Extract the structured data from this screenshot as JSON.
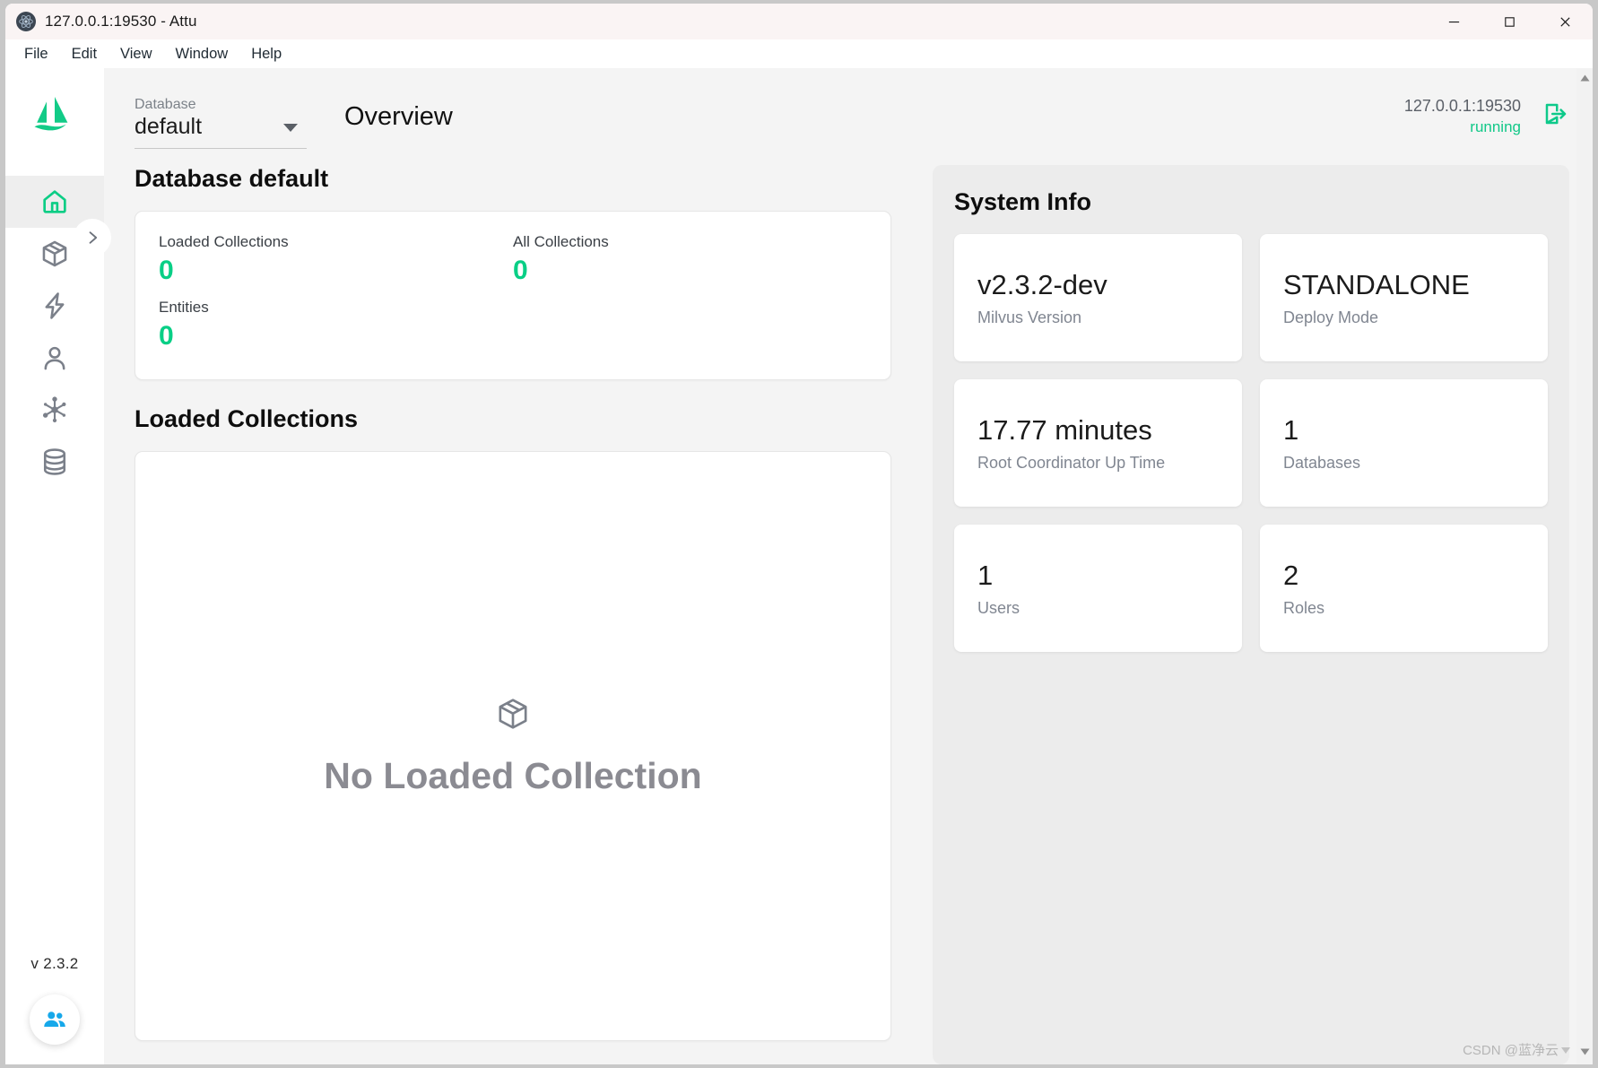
{
  "window": {
    "title": "127.0.0.1:19530 - Attu",
    "app_icon": "electron-icon",
    "controls": {
      "minimize": "minimize-icon",
      "maximize": "maximize-icon",
      "close": "close-icon"
    }
  },
  "menubar": {
    "items": [
      "File",
      "Edit",
      "View",
      "Window",
      "Help"
    ]
  },
  "sidebar": {
    "logo": "milvus-logo",
    "expand_icon": "chevron-right-icon",
    "items": [
      {
        "name": "home",
        "icon": "home-icon",
        "active": true
      },
      {
        "name": "collections",
        "icon": "box-icon",
        "active": false
      },
      {
        "name": "vector-search",
        "icon": "lightning-icon",
        "active": false
      },
      {
        "name": "users",
        "icon": "person-icon",
        "active": false
      },
      {
        "name": "system-view",
        "icon": "network-nodes-icon",
        "active": false
      },
      {
        "name": "databases",
        "icon": "database-icon",
        "active": false
      }
    ],
    "version": "v 2.3.2",
    "fab_icon": "people-icon"
  },
  "topbar": {
    "db_label": "Database",
    "db_value": "default",
    "caret_icon": "chevron-down-icon",
    "page_title": "Overview",
    "connection_address": "127.0.0.1:19530",
    "connection_status": "running",
    "disconnect_icon": "logout-icon"
  },
  "database_section": {
    "title": "Database default",
    "stats": [
      {
        "label": "Loaded Collections",
        "value": "0"
      },
      {
        "label": "Entities",
        "value": "0"
      },
      {
        "label": "All Collections",
        "value": "0"
      }
    ]
  },
  "loaded_collections": {
    "title": "Loaded Collections",
    "empty_icon": "box-icon",
    "empty_text": "No Loaded Collection"
  },
  "system_info": {
    "title": "System Info",
    "cards": [
      {
        "value": "v2.3.2-dev",
        "caption": "Milvus Version"
      },
      {
        "value": "STANDALONE",
        "caption": "Deploy Mode"
      },
      {
        "value": "17.77 minutes",
        "caption": "Root Coordinator Up Time"
      },
      {
        "value": "1",
        "caption": "Databases"
      },
      {
        "value": "1",
        "caption": "Users"
      },
      {
        "value": "2",
        "caption": "Roles"
      }
    ]
  },
  "scrollbar": {
    "up_icon": "triangle-up-icon",
    "down_icon": "triangle-down-icon"
  },
  "watermark": {
    "text": "CSDN @蓝净云"
  },
  "colors": {
    "accent_green": "#09cf86",
    "status_green": "#12c888",
    "fab_blue": "#17a2e8",
    "page_bg": "#f4f4f4",
    "panel_bg": "#ececec"
  }
}
